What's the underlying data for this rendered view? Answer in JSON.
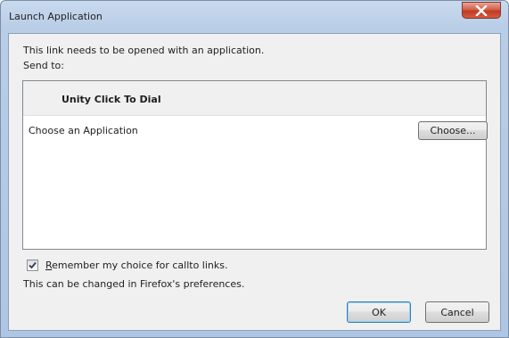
{
  "window": {
    "title": "Launch Application",
    "close_icon": "close-icon"
  },
  "dialog": {
    "message": "This link needs to be opened with an application.",
    "send_to_label": "Send to:",
    "list": {
      "header": "Unity Click To Dial",
      "choose_label": "Choose an Application",
      "choose_button": "Choose..."
    },
    "remember": {
      "label": "Remember my choice for callto links.",
      "checked": true
    },
    "note": "This can be changed in Firefox's preferences.",
    "ok_button": "OK",
    "cancel_button": "Cancel"
  },
  "colors": {
    "title_gradient_top": "#c9daee",
    "client_background": "#f0f0f0",
    "close_button_red": "#c13b22",
    "default_button_border": "#3c7fb1"
  }
}
